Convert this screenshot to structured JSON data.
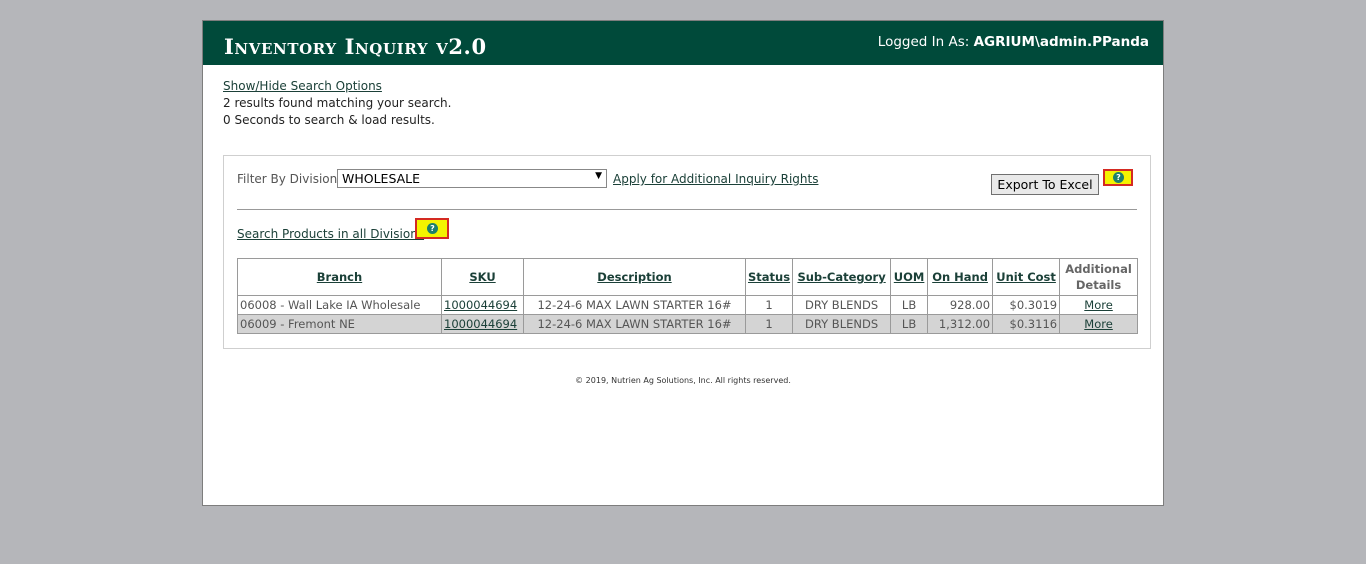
{
  "header": {
    "title": "Inventory Inquiry v2.0",
    "login_prefix": "Logged In As:",
    "login_user": "AGRIUM\\admin.PPanda"
  },
  "info": {
    "toggle_link": "Show/Hide Search Options",
    "results_found": "2 results found matching your search.",
    "search_time": "0 Seconds to search & load results."
  },
  "filter": {
    "label": "Filter By Division:",
    "selected": "WHOLESALE",
    "apply_link": "Apply for Additional Inquiry Rights",
    "export_label": "Export To Excel",
    "search_all_link": "Search Products in all Divisions",
    "help_icon": "question-icon"
  },
  "table": {
    "headers": {
      "branch": "Branch",
      "sku": "SKU",
      "description": "Description",
      "status": "Status",
      "subcategory": "Sub-Category",
      "uom": "UOM",
      "onhand": "On Hand",
      "unitcost": "Unit Cost",
      "additional_line1": "Additional",
      "additional_line2": "Details"
    },
    "rows": [
      {
        "branch": "06008 - Wall Lake IA Wholesale",
        "sku": "1000044694",
        "description": "12-24-6 MAX LAWN STARTER 16#",
        "status": "1",
        "subcategory": "DRY BLENDS",
        "uom": "LB",
        "onhand": "928.00",
        "unitcost": "$0.3019",
        "details": "More"
      },
      {
        "branch": "06009 - Fremont NE",
        "sku": "1000044694",
        "description": "12-24-6 MAX LAWN STARTER 16#",
        "status": "1",
        "subcategory": "DRY BLENDS",
        "uom": "LB",
        "onhand": "1,312.00",
        "unitcost": "$0.3116",
        "details": "More"
      }
    ]
  },
  "footer": {
    "copyright": "© 2019, Nutrien Ag Solutions, Inc. All rights reserved."
  },
  "colors": {
    "header_bg": "#004a3a",
    "page_bg": "#b5b6ba",
    "help_highlight": "#f4f300",
    "help_border": "#d42a22"
  }
}
